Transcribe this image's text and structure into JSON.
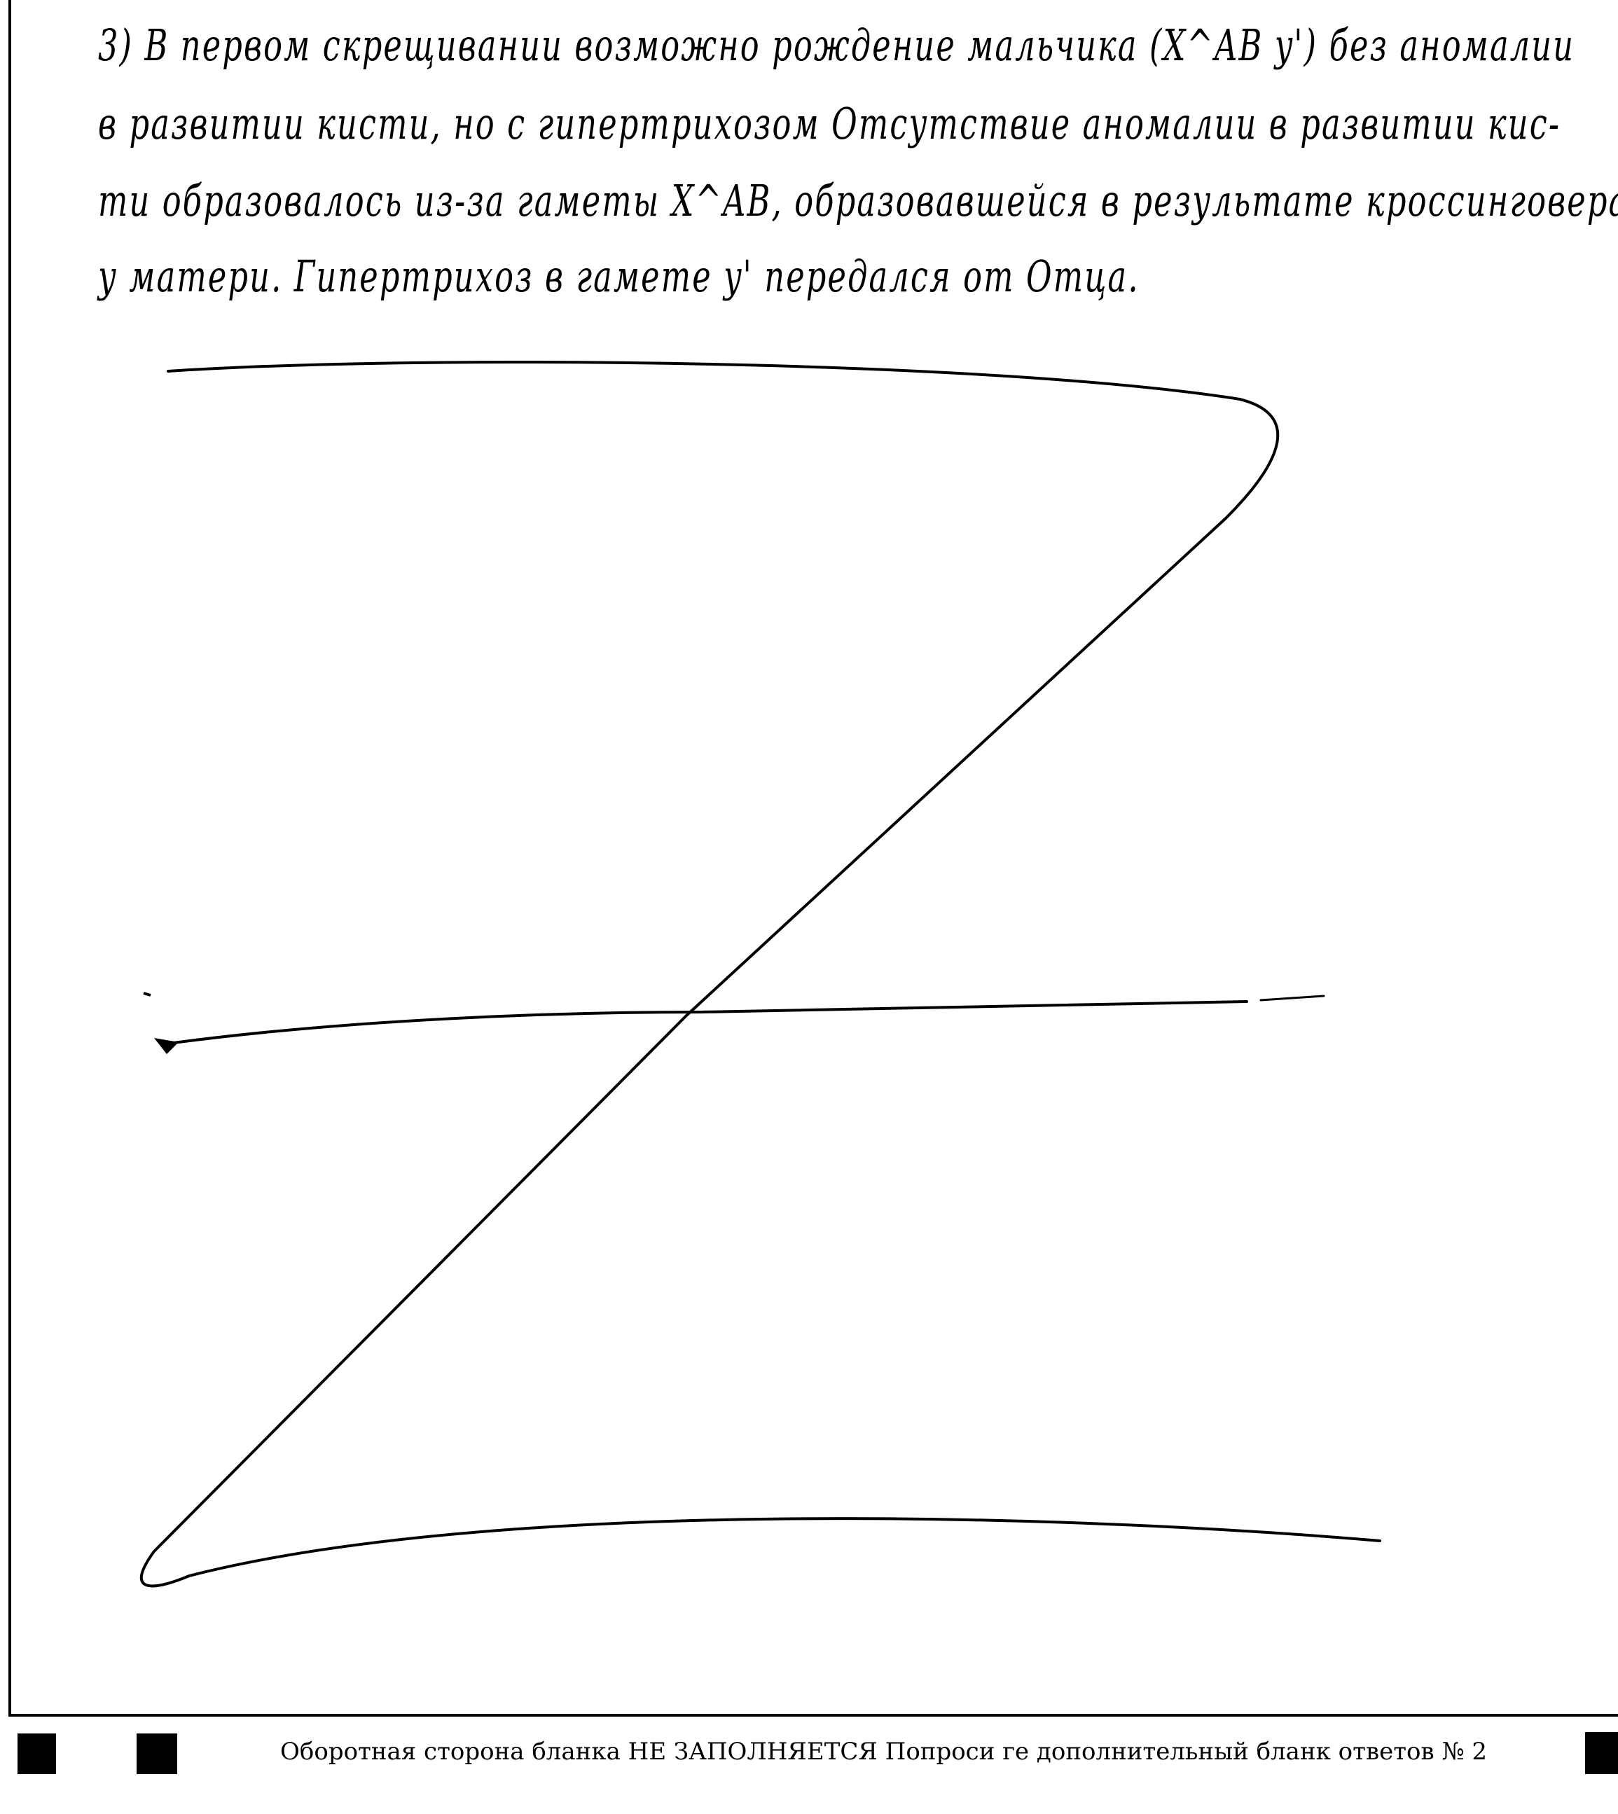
{
  "answer": {
    "lines": [
      "3) В первом скрещивании возможно рождение мальчика (X^AB y') без аномалии",
      "в развитии кисти, но с гипертрихозом Отсутствие аномалии в развитии кис-",
      "ти образовалось из-за гаметы X^AB, образовавшейся в результате кроссинговера",
      "у матери. Гипертрихоз в гамете y' передался от Отца."
    ]
  },
  "footer": {
    "note": "Оборотная сторона бланка НЕ ЗАПОЛНЯЕТСЯ  Попроси ге дополнительный бланк ответов № 2"
  }
}
